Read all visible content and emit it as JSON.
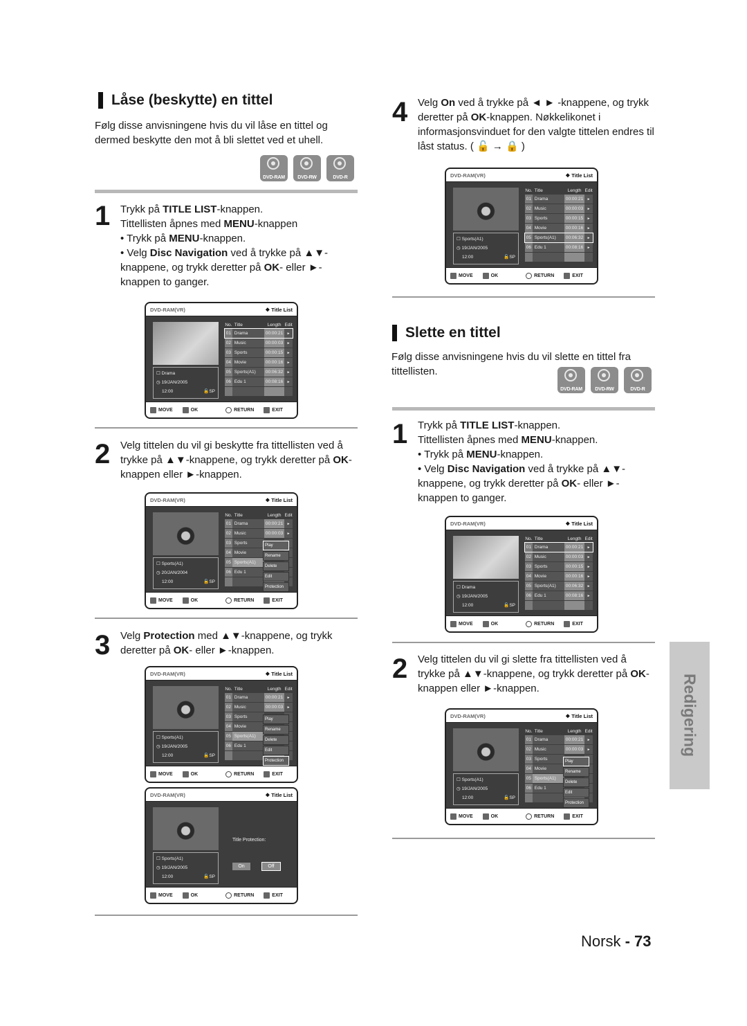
{
  "left": {
    "section_title": "Låse (beskytte) en tittel",
    "intro": "Følg disse anvisningene hvis du vil låse en tittel og dermed beskytte den mot å bli slettet ved et uhell.",
    "discs": [
      "DVD-RAM",
      "DVD-RW",
      "DVD-R"
    ],
    "steps": [
      {
        "number": "1",
        "lines": [
          {
            "pre": "Trykk på ",
            "bold": "TITLE LIST",
            "post": "-knappen."
          },
          {
            "pre": "Tittellisten åpnes med ",
            "bold": "MENU",
            "post": "-knappen"
          }
        ],
        "bullets": [
          {
            "pre": "• Trykk på ",
            "bold": "MENU",
            "post": "-knappen."
          },
          {
            "pre": "• Velg ",
            "bold": "Disc Navigation",
            "post": " ved å trykke på ▲▼- knappene, og trykk deretter på ",
            "bold2": "OK",
            "post2": "- eller ►- knappen to ganger."
          }
        ]
      },
      {
        "number": "2",
        "text_pre": "Velg tittelen du vil gi beskytte fra tittellisten ved å trykke på ▲▼-knappene, og trykk deretter på ",
        "bold": "OK",
        "text_post": "- knappen eller ►-knappen."
      },
      {
        "number": "3",
        "text_pre": "Velg ",
        "bold": "Protection",
        "text_mid": " med ▲▼-knappene, og trykk deretter på ",
        "bold2": "OK",
        "text_post": "- eller ►-knappen."
      }
    ]
  },
  "right": {
    "step4": {
      "number": "4",
      "pre": "Velg ",
      "bold": "On",
      "mid": " ved å trykke på ◄ ► -knappene, og trykk deretter på ",
      "bold2": "OK",
      "post": "-knappen. Nøkkelikonet i informasjonsvinduet for den valgte tittelen endres til låst status. ( 🔓 → 🔒 )"
    },
    "section_title": "Slette en tittel",
    "intro": "Følg disse anvisningene hvis du vil slette en tittel fra tittellisten.",
    "discs": [
      "DVD-RAM",
      "DVD-RW",
      "DVD-R"
    ],
    "steps": [
      {
        "number": "1",
        "lines": [
          {
            "pre": "Trykk på ",
            "bold": "TITLE LIST",
            "post": "-knappen."
          },
          {
            "pre": "Tittellisten åpnes med ",
            "bold": "MENU",
            "post": "-knappen."
          }
        ],
        "bullets": [
          {
            "pre": "• Trykk på ",
            "bold": "MENU",
            "post": "-knappen."
          },
          {
            "pre": "• Velg ",
            "bold": "Disc Navigation",
            "post": " ved å trykke på ▲▼-knappene, og trykk deretter på ",
            "bold2": "OK",
            "post2": "- eller ►-knappen to ganger."
          }
        ]
      },
      {
        "number": "2",
        "text_pre": "Velg tittelen du vil gi slette fra tittellisten ved å trykke på ▲▼-knappene, og trykk deretter på ",
        "bold": "OK",
        "text_post": "- knappen eller ►-knappen."
      }
    ]
  },
  "osd": {
    "mode": "DVD-RAM(VR)",
    "title": "❖ Title List",
    "headers": [
      "No.",
      "Title",
      "Length",
      "Edit"
    ],
    "rows": [
      {
        "no": "01",
        "title": "Drama",
        "length": "00:00:21"
      },
      {
        "no": "02",
        "title": "Music",
        "length": "00:00:03"
      },
      {
        "no": "03",
        "title": "Sports",
        "length": "00:00:15"
      },
      {
        "no": "04",
        "title": "Movie",
        "length": "00:00:16"
      },
      {
        "no": "05",
        "title": "Sports(A1)",
        "length": "00:06:32"
      },
      {
        "no": "06",
        "title": "Edu 1",
        "length": "00:08:16"
      }
    ],
    "edit_arrow": "►",
    "popup": [
      "Play",
      "Rename",
      "Delete",
      "Edit",
      "Protection"
    ],
    "footer": {
      "move": "MOVE",
      "ok": "OK",
      "return": "RETURN",
      "exit": "EXIT"
    },
    "info_drama": {
      "title": "Drama",
      "date": "19/JAN/2005",
      "time": "12:00",
      "quality": "SP"
    },
    "info_sports_2004": {
      "title": "Sports(A1)",
      "date": "20/JAN/2004",
      "time": "12:00",
      "quality": "SP"
    },
    "info_sports": {
      "title": "Sports(A1)",
      "date": "19/JAN/2005",
      "time": "12:00",
      "quality": "SP"
    },
    "protection_label": "Title Protection:",
    "on": "On",
    "off": "Off"
  },
  "side_tab": "Redigering",
  "page": {
    "lang": "Norsk",
    "sep": " - ",
    "number": "73"
  }
}
